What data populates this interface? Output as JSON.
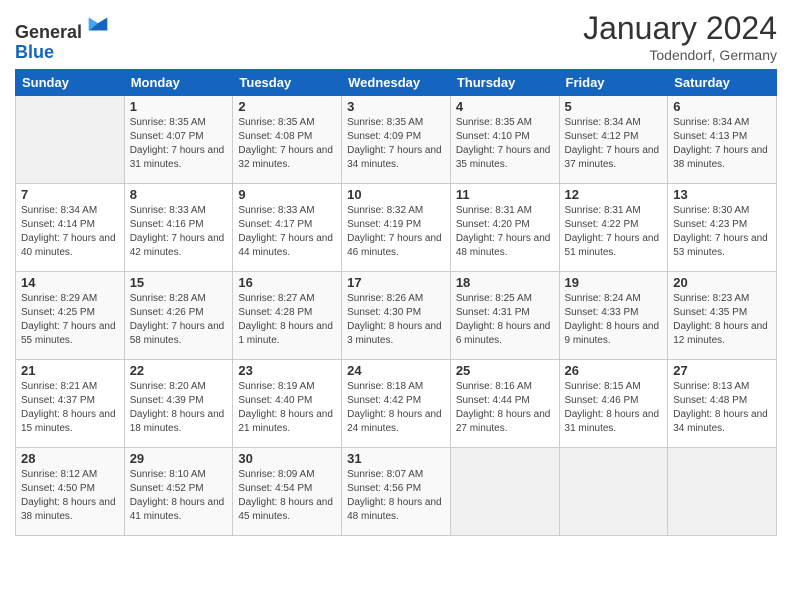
{
  "logo": {
    "general": "General",
    "blue": "Blue"
  },
  "header": {
    "month_year": "January 2024",
    "location": "Todendorf, Germany"
  },
  "days_of_week": [
    "Sunday",
    "Monday",
    "Tuesday",
    "Wednesday",
    "Thursday",
    "Friday",
    "Saturday"
  ],
  "weeks": [
    [
      {
        "day": "",
        "sunrise": "",
        "sunset": "",
        "daylight": ""
      },
      {
        "day": "1",
        "sunrise": "Sunrise: 8:35 AM",
        "sunset": "Sunset: 4:07 PM",
        "daylight": "Daylight: 7 hours and 31 minutes."
      },
      {
        "day": "2",
        "sunrise": "Sunrise: 8:35 AM",
        "sunset": "Sunset: 4:08 PM",
        "daylight": "Daylight: 7 hours and 32 minutes."
      },
      {
        "day": "3",
        "sunrise": "Sunrise: 8:35 AM",
        "sunset": "Sunset: 4:09 PM",
        "daylight": "Daylight: 7 hours and 34 minutes."
      },
      {
        "day": "4",
        "sunrise": "Sunrise: 8:35 AM",
        "sunset": "Sunset: 4:10 PM",
        "daylight": "Daylight: 7 hours and 35 minutes."
      },
      {
        "day": "5",
        "sunrise": "Sunrise: 8:34 AM",
        "sunset": "Sunset: 4:12 PM",
        "daylight": "Daylight: 7 hours and 37 minutes."
      },
      {
        "day": "6",
        "sunrise": "Sunrise: 8:34 AM",
        "sunset": "Sunset: 4:13 PM",
        "daylight": "Daylight: 7 hours and 38 minutes."
      }
    ],
    [
      {
        "day": "7",
        "sunrise": "Sunrise: 8:34 AM",
        "sunset": "Sunset: 4:14 PM",
        "daylight": "Daylight: 7 hours and 40 minutes."
      },
      {
        "day": "8",
        "sunrise": "Sunrise: 8:33 AM",
        "sunset": "Sunset: 4:16 PM",
        "daylight": "Daylight: 7 hours and 42 minutes."
      },
      {
        "day": "9",
        "sunrise": "Sunrise: 8:33 AM",
        "sunset": "Sunset: 4:17 PM",
        "daylight": "Daylight: 7 hours and 44 minutes."
      },
      {
        "day": "10",
        "sunrise": "Sunrise: 8:32 AM",
        "sunset": "Sunset: 4:19 PM",
        "daylight": "Daylight: 7 hours and 46 minutes."
      },
      {
        "day": "11",
        "sunrise": "Sunrise: 8:31 AM",
        "sunset": "Sunset: 4:20 PM",
        "daylight": "Daylight: 7 hours and 48 minutes."
      },
      {
        "day": "12",
        "sunrise": "Sunrise: 8:31 AM",
        "sunset": "Sunset: 4:22 PM",
        "daylight": "Daylight: 7 hours and 51 minutes."
      },
      {
        "day": "13",
        "sunrise": "Sunrise: 8:30 AM",
        "sunset": "Sunset: 4:23 PM",
        "daylight": "Daylight: 7 hours and 53 minutes."
      }
    ],
    [
      {
        "day": "14",
        "sunrise": "Sunrise: 8:29 AM",
        "sunset": "Sunset: 4:25 PM",
        "daylight": "Daylight: 7 hours and 55 minutes."
      },
      {
        "day": "15",
        "sunrise": "Sunrise: 8:28 AM",
        "sunset": "Sunset: 4:26 PM",
        "daylight": "Daylight: 7 hours and 58 minutes."
      },
      {
        "day": "16",
        "sunrise": "Sunrise: 8:27 AM",
        "sunset": "Sunset: 4:28 PM",
        "daylight": "Daylight: 8 hours and 1 minute."
      },
      {
        "day": "17",
        "sunrise": "Sunrise: 8:26 AM",
        "sunset": "Sunset: 4:30 PM",
        "daylight": "Daylight: 8 hours and 3 minutes."
      },
      {
        "day": "18",
        "sunrise": "Sunrise: 8:25 AM",
        "sunset": "Sunset: 4:31 PM",
        "daylight": "Daylight: 8 hours and 6 minutes."
      },
      {
        "day": "19",
        "sunrise": "Sunrise: 8:24 AM",
        "sunset": "Sunset: 4:33 PM",
        "daylight": "Daylight: 8 hours and 9 minutes."
      },
      {
        "day": "20",
        "sunrise": "Sunrise: 8:23 AM",
        "sunset": "Sunset: 4:35 PM",
        "daylight": "Daylight: 8 hours and 12 minutes."
      }
    ],
    [
      {
        "day": "21",
        "sunrise": "Sunrise: 8:21 AM",
        "sunset": "Sunset: 4:37 PM",
        "daylight": "Daylight: 8 hours and 15 minutes."
      },
      {
        "day": "22",
        "sunrise": "Sunrise: 8:20 AM",
        "sunset": "Sunset: 4:39 PM",
        "daylight": "Daylight: 8 hours and 18 minutes."
      },
      {
        "day": "23",
        "sunrise": "Sunrise: 8:19 AM",
        "sunset": "Sunset: 4:40 PM",
        "daylight": "Daylight: 8 hours and 21 minutes."
      },
      {
        "day": "24",
        "sunrise": "Sunrise: 8:18 AM",
        "sunset": "Sunset: 4:42 PM",
        "daylight": "Daylight: 8 hours and 24 minutes."
      },
      {
        "day": "25",
        "sunrise": "Sunrise: 8:16 AM",
        "sunset": "Sunset: 4:44 PM",
        "daylight": "Daylight: 8 hours and 27 minutes."
      },
      {
        "day": "26",
        "sunrise": "Sunrise: 8:15 AM",
        "sunset": "Sunset: 4:46 PM",
        "daylight": "Daylight: 8 hours and 31 minutes."
      },
      {
        "day": "27",
        "sunrise": "Sunrise: 8:13 AM",
        "sunset": "Sunset: 4:48 PM",
        "daylight": "Daylight: 8 hours and 34 minutes."
      }
    ],
    [
      {
        "day": "28",
        "sunrise": "Sunrise: 8:12 AM",
        "sunset": "Sunset: 4:50 PM",
        "daylight": "Daylight: 8 hours and 38 minutes."
      },
      {
        "day": "29",
        "sunrise": "Sunrise: 8:10 AM",
        "sunset": "Sunset: 4:52 PM",
        "daylight": "Daylight: 8 hours and 41 minutes."
      },
      {
        "day": "30",
        "sunrise": "Sunrise: 8:09 AM",
        "sunset": "Sunset: 4:54 PM",
        "daylight": "Daylight: 8 hours and 45 minutes."
      },
      {
        "day": "31",
        "sunrise": "Sunrise: 8:07 AM",
        "sunset": "Sunset: 4:56 PM",
        "daylight": "Daylight: 8 hours and 48 minutes."
      },
      {
        "day": "",
        "sunrise": "",
        "sunset": "",
        "daylight": ""
      },
      {
        "day": "",
        "sunrise": "",
        "sunset": "",
        "daylight": ""
      },
      {
        "day": "",
        "sunrise": "",
        "sunset": "",
        "daylight": ""
      }
    ]
  ]
}
